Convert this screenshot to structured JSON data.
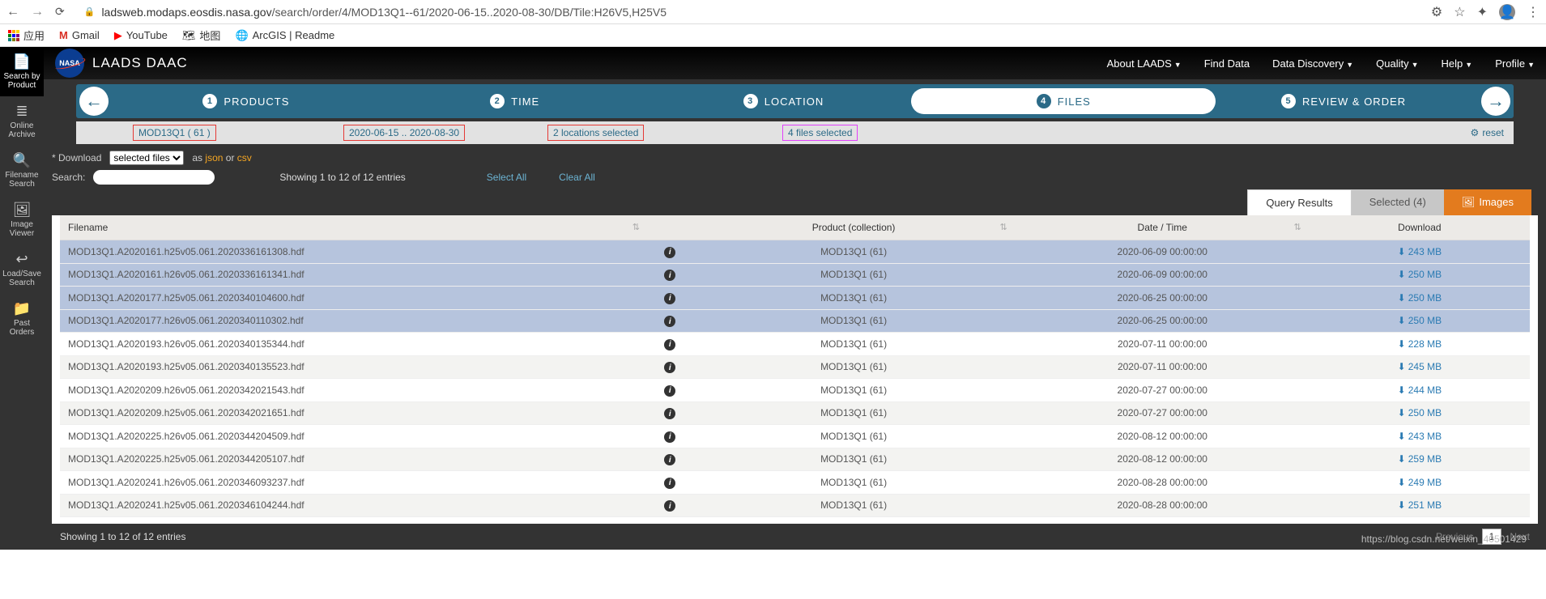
{
  "browser": {
    "url_domain": "ladsweb.modaps.eosdis.nasa.gov",
    "url_path": "/search/order/4/MOD13Q1--61/2020-06-15..2020-08-30/DB/Tile:H26V5,H25V5"
  },
  "bookmarks": {
    "apps": "应用",
    "gmail": "Gmail",
    "youtube": "YouTube",
    "map": "地图",
    "arcgis": "ArcGIS | Readme"
  },
  "site": {
    "title": "LAADS DAAC"
  },
  "topnav": [
    "About LAADS",
    "Find Data",
    "Data Discovery",
    "Quality",
    "Help",
    "Profile"
  ],
  "topnav_caret": [
    true,
    false,
    true,
    true,
    true,
    true
  ],
  "sidenav": [
    {
      "icon": "📄",
      "label": "Search by Product"
    },
    {
      "icon": "≣",
      "label": "Online Archive"
    },
    {
      "icon": "🔍",
      "label": "Filename Search"
    },
    {
      "icon": "🖼",
      "label": "Image Viewer"
    },
    {
      "icon": "↩",
      "label": "Load/Save Search"
    },
    {
      "icon": "📁",
      "label": "Past Orders"
    }
  ],
  "wizard": {
    "steps": [
      "PRODUCTS",
      "TIME",
      "LOCATION",
      "FILES",
      "REVIEW & ORDER"
    ],
    "active": 3
  },
  "subwiz": {
    "product": "MOD13Q1 ( 61 )",
    "time": "2020-06-15 .. 2020-08-30",
    "location": "2 locations selected",
    "files": "4 files selected",
    "reset": "reset"
  },
  "controls": {
    "dl_label": "* Download",
    "dl_select": "selected files",
    "as": "as",
    "json": "json",
    "or": "or",
    "csv": "csv",
    "search_label": "Search:",
    "showing": "Showing 1 to 12 of 12 entries",
    "select_all": "Select All",
    "clear_all": "Clear All"
  },
  "tabs": {
    "qr": "Query Results",
    "sel": "Selected (4)",
    "img": "Images"
  },
  "table": {
    "headers": {
      "filename": "Filename",
      "product": "Product (collection)",
      "datetime": "Date / Time",
      "download": "Download"
    },
    "rows": [
      {
        "sel": true,
        "fn": "MOD13Q1.A2020161.h25v05.061.2020336161308.hdf",
        "prod": "MOD13Q1 (61)",
        "dt": "2020-06-09 00:00:00",
        "dl": "243 MB"
      },
      {
        "sel": true,
        "fn": "MOD13Q1.A2020161.h26v05.061.2020336161341.hdf",
        "prod": "MOD13Q1 (61)",
        "dt": "2020-06-09 00:00:00",
        "dl": "250 MB"
      },
      {
        "sel": true,
        "fn": "MOD13Q1.A2020177.h25v05.061.2020340104600.hdf",
        "prod": "MOD13Q1 (61)",
        "dt": "2020-06-25 00:00:00",
        "dl": "250 MB"
      },
      {
        "sel": true,
        "fn": "MOD13Q1.A2020177.h26v05.061.2020340110302.hdf",
        "prod": "MOD13Q1 (61)",
        "dt": "2020-06-25 00:00:00",
        "dl": "250 MB"
      },
      {
        "sel": false,
        "fn": "MOD13Q1.A2020193.h26v05.061.2020340135344.hdf",
        "prod": "MOD13Q1 (61)",
        "dt": "2020-07-11 00:00:00",
        "dl": "228 MB"
      },
      {
        "sel": false,
        "fn": "MOD13Q1.A2020193.h25v05.061.2020340135523.hdf",
        "prod": "MOD13Q1 (61)",
        "dt": "2020-07-11 00:00:00",
        "dl": "245 MB"
      },
      {
        "sel": false,
        "fn": "MOD13Q1.A2020209.h26v05.061.2020342021543.hdf",
        "prod": "MOD13Q1 (61)",
        "dt": "2020-07-27 00:00:00",
        "dl": "244 MB"
      },
      {
        "sel": false,
        "fn": "MOD13Q1.A2020209.h25v05.061.2020342021651.hdf",
        "prod": "MOD13Q1 (61)",
        "dt": "2020-07-27 00:00:00",
        "dl": "250 MB"
      },
      {
        "sel": false,
        "fn": "MOD13Q1.A2020225.h26v05.061.2020344204509.hdf",
        "prod": "MOD13Q1 (61)",
        "dt": "2020-08-12 00:00:00",
        "dl": "243 MB"
      },
      {
        "sel": false,
        "fn": "MOD13Q1.A2020225.h25v05.061.2020344205107.hdf",
        "prod": "MOD13Q1 (61)",
        "dt": "2020-08-12 00:00:00",
        "dl": "259 MB"
      },
      {
        "sel": false,
        "fn": "MOD13Q1.A2020241.h26v05.061.2020346093237.hdf",
        "prod": "MOD13Q1 (61)",
        "dt": "2020-08-28 00:00:00",
        "dl": "249 MB"
      },
      {
        "sel": false,
        "fn": "MOD13Q1.A2020241.h25v05.061.2020346104244.hdf",
        "prod": "MOD13Q1 (61)",
        "dt": "2020-08-28 00:00:00",
        "dl": "251 MB"
      }
    ]
  },
  "footer": {
    "showing": "Showing 1 to 12 of 12 entries",
    "prev": "Previous",
    "next": "Next",
    "page": "1"
  },
  "watermark": "https://blog.csdn.net/weixin_40501429"
}
